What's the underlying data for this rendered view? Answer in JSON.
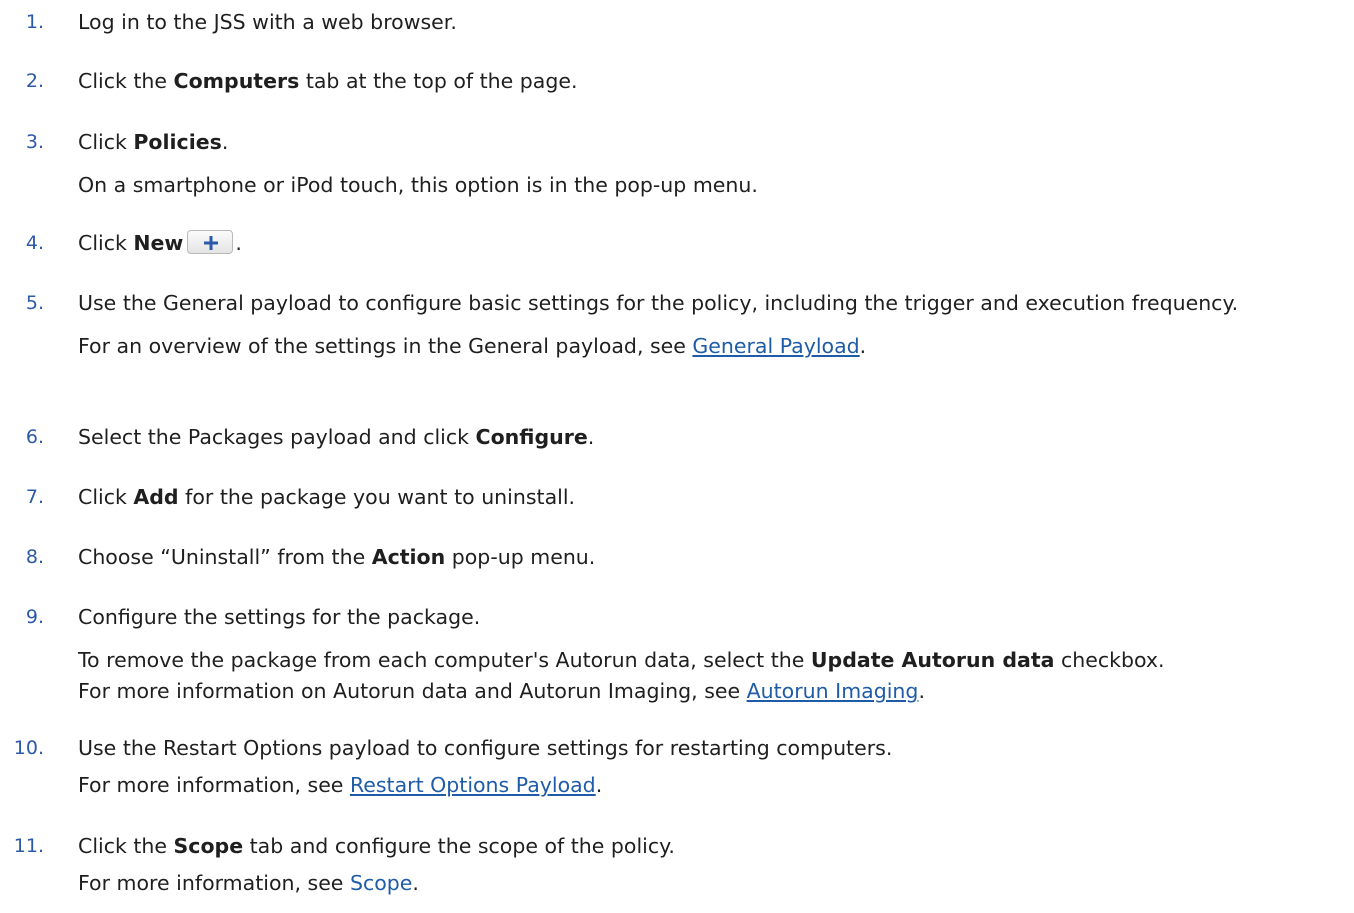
{
  "steps": [
    {
      "num": "1.",
      "text": "Log in to the JSS with a web browser."
    },
    {
      "num": "2.",
      "pre": "Click the ",
      "bold": "Computers",
      "post": " tab at the top of the page."
    },
    {
      "num": "3.",
      "pre": "Click ",
      "bold": "Policies",
      "post": ".",
      "sub": "On a smartphone or iPod touch, this option is in the pop-up menu."
    },
    {
      "num": "4.",
      "pre": "Click ",
      "bold": "New",
      "post": ".",
      "button_icon": "plus-icon"
    },
    {
      "num": "5.",
      "text": "Use the General payload to configure basic settings for the policy, including the trigger and execution frequency.",
      "sub_pre": "For an overview of the settings in the General payload, see ",
      "sub_link": "General Payload",
      "sub_post": "."
    },
    {
      "num": "6.",
      "pre": "Select the Packages payload and click ",
      "bold": "Configure",
      "post": "."
    },
    {
      "num": "7.",
      "pre": "Click ",
      "bold": "Add",
      "post": " for the package you want to uninstall."
    },
    {
      "num": "8.",
      "pre": "Choose “Uninstall” from the ",
      "bold": "Action",
      "post": " pop-up menu."
    },
    {
      "num": "9.",
      "text": "Configure the settings for the package.",
      "sub_pre": "To remove the package from each computer's Autorun data, select the ",
      "sub_bold": "Update Autorun data",
      "sub_mid": " checkbox.",
      "sub2_pre": "For more information on Autorun data and Autorun Imaging, see ",
      "sub2_link": "Autorun Imaging",
      "sub2_post": "."
    },
    {
      "num": "10.",
      "text": "Use the Restart Options payload to configure settings for restarting computers.",
      "sub_pre": "For more information, see ",
      "sub_link": "Restart Options Payload",
      "sub_post": "."
    },
    {
      "num": "11.",
      "pre": "Click the ",
      "bold": "Scope",
      "post": " tab and configure the scope of the policy.",
      "sub_pre": "For more information, see ",
      "sub_link": "Scope",
      "sub_post": "."
    }
  ]
}
